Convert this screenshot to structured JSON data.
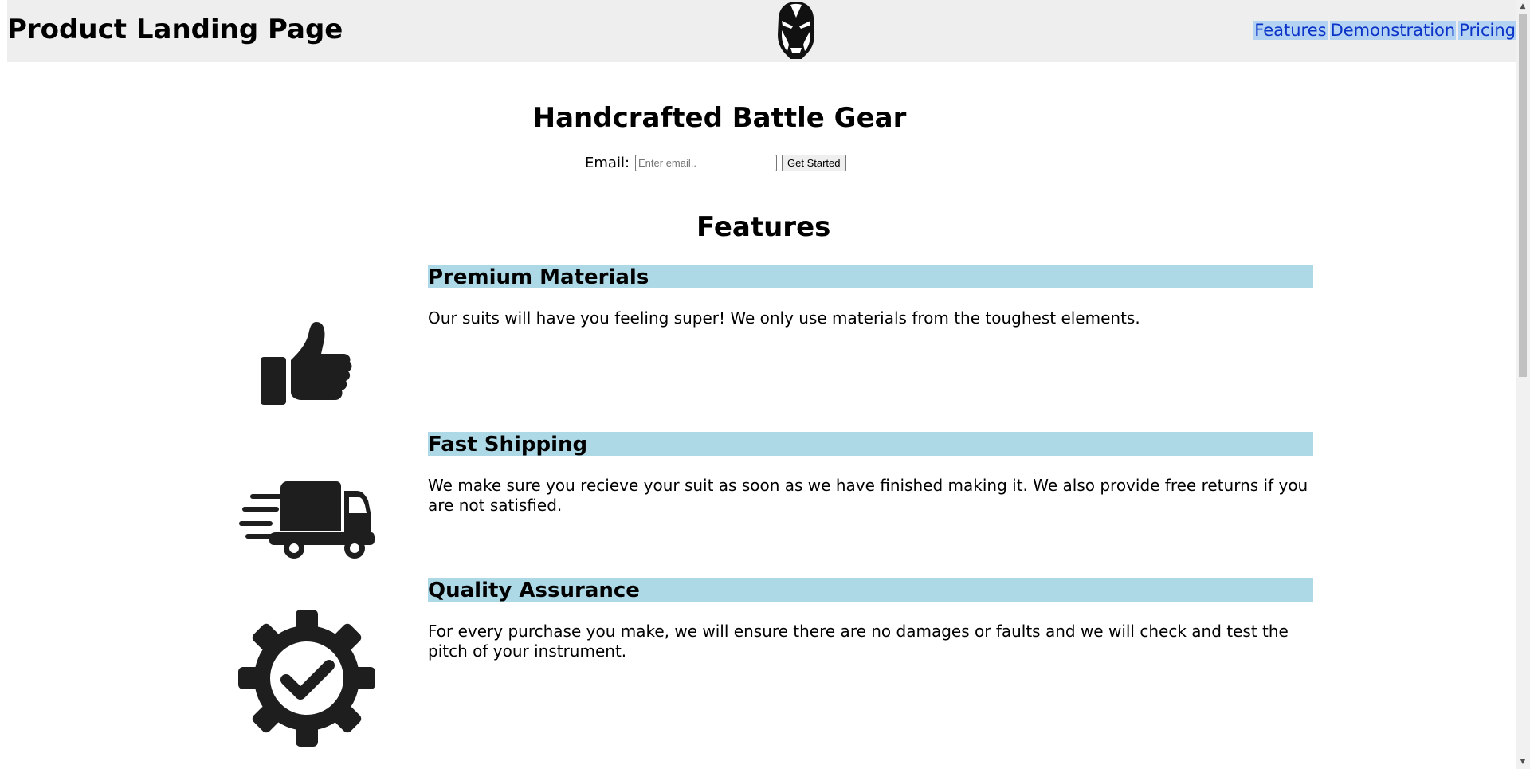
{
  "header": {
    "title": "Product Landing Page",
    "nav": [
      {
        "label": "Features"
      },
      {
        "label": "Demonstration"
      },
      {
        "label": "Pricing"
      }
    ],
    "logo_icon": "iron-man-helmet-icon"
  },
  "hero": {
    "title": "Handcrafted Battle Gear",
    "email_label": "Email:",
    "email_placeholder": "Enter email..",
    "email_value": "",
    "submit_label": "Get Started"
  },
  "features": {
    "title": "Features",
    "items": [
      {
        "heading": "Premium Materials",
        "text": "Our suits will have you feeling super! We only use materials from the toughest elements.",
        "icon": "thumbs-up-icon"
      },
      {
        "heading": "Fast Shipping",
        "text": "We make sure you recieve your suit as soon as we have finished making it. We also provide free returns if you are not satisfied.",
        "icon": "delivery-truck-icon"
      },
      {
        "heading": "Quality Assurance",
        "text": "For every purchase you make, we will ensure there are no damages or faults and we will check and test the pitch of your instrument.",
        "icon": "gear-check-icon"
      }
    ]
  },
  "colors": {
    "header_bg": "#eeeeee",
    "feature_heading_bg": "#add8e6",
    "nav_highlight": "#b4d3f3",
    "nav_link": "#0b33c8"
  }
}
